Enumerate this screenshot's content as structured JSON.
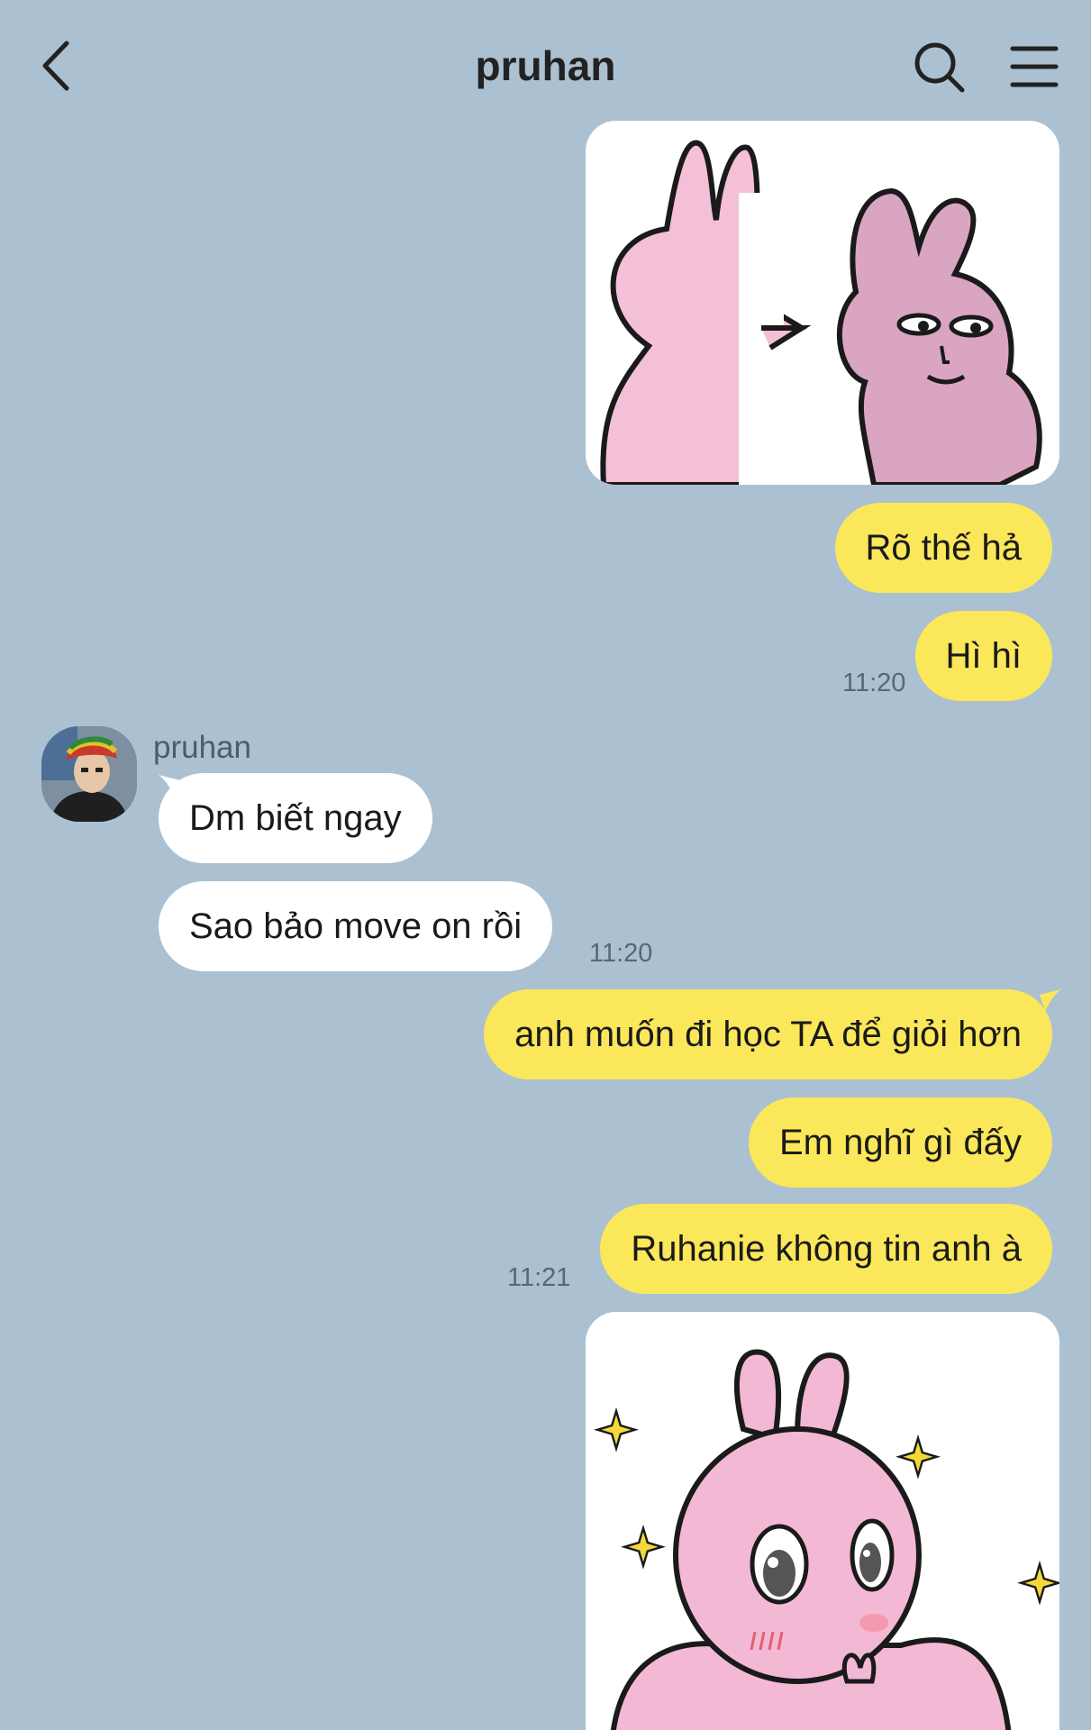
{
  "header": {
    "title": "pruhan",
    "back_icon": "chevron-left-icon",
    "search_icon": "search-icon",
    "menu_icon": "hamburger-menu-icon"
  },
  "colors": {
    "background": "#abc1d1",
    "my_bubble": "#fbe75a",
    "their_bubble": "#ffffff"
  },
  "messages": [
    {
      "side": "me",
      "type": "sticker",
      "content": "pink-rabbit-sticker"
    },
    {
      "side": "me",
      "type": "text",
      "text": "Rõ thế hả"
    },
    {
      "side": "me",
      "type": "text",
      "text": "Hì hì",
      "time": "11:20"
    },
    {
      "side": "them",
      "sender": "pruhan",
      "type": "text",
      "text": "Dm biết ngay"
    },
    {
      "side": "them",
      "type": "text",
      "text": "Sao bảo move on rồi",
      "time": "11:20"
    },
    {
      "side": "me",
      "type": "text",
      "text": "anh muốn đi học TA để giỏi hơn"
    },
    {
      "side": "me",
      "type": "text",
      "text": "Em nghĩ gì đấy"
    },
    {
      "side": "me",
      "type": "text",
      "text": "Ruhanie không tin anh à",
      "time": "11:21"
    },
    {
      "side": "me",
      "type": "sticker",
      "content": "pink-rabbit-sparkle-sticker"
    }
  ]
}
